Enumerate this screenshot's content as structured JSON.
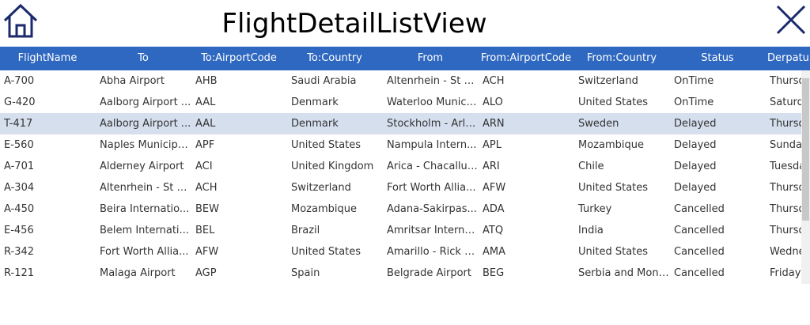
{
  "header": {
    "title": "FlightDetailListView",
    "home_icon": "home-icon",
    "close_icon": "close-icon",
    "icon_color": "#1a2a6c"
  },
  "table": {
    "header_color": "#2f68c0",
    "selected_row_color": "#d5dfee",
    "columns": [
      "FlightName",
      "To",
      "To:AirportCode",
      "To:Country",
      "From",
      "From:AirportCode",
      "From:Country",
      "Status",
      "Derpatu"
    ],
    "rows": [
      [
        "A-700",
        "Abha Airport",
        "AHB",
        "Saudi Arabia",
        "Altenrhein - St G...",
        "ACH",
        "Switzerland",
        "OnTime",
        "Thursd"
      ],
      [
        "G-420",
        "Aalborg Airport ...",
        "AAL",
        "Denmark",
        "Waterloo Munici...",
        "ALO",
        "United States",
        "OnTime",
        "Saturd"
      ],
      [
        "T-417",
        "Aalborg Airport ...",
        "AAL",
        "Denmark",
        "Stockholm - Arla...",
        "ARN",
        "Sweden",
        "Delayed",
        "Thursd"
      ],
      [
        "E-560",
        "Naples Municipa...",
        "APF",
        "United States",
        "Nampula Intern...",
        "APL",
        "Mozambique",
        "Delayed",
        "Sunday"
      ],
      [
        "A-701",
        "Alderney Airport",
        "ACI",
        "United Kingdom",
        "Arica - Chacallut...",
        "ARI",
        "Chile",
        "Delayed",
        "Tuesda"
      ],
      [
        "A-304",
        "Altenrhein - St G...",
        "ACH",
        "Switzerland",
        "Fort Worth Allia...",
        "AFW",
        "United States",
        "Delayed",
        "Thursd"
      ],
      [
        "A-450",
        "Beira Internatio...",
        "BEW",
        "Mozambique",
        "Adana-Sakirpas...",
        "ADA",
        "Turkey",
        "Cancelled",
        "Thursd"
      ],
      [
        "E-456",
        "Belem Internati...",
        "BEL",
        "Brazil",
        "Amritsar Interna...",
        "ATQ",
        "India",
        "Cancelled",
        "Thursd"
      ],
      [
        "R-342",
        "Fort Worth Allia...",
        "AFW",
        "United States",
        "Amarillo - Rick H...",
        "AMA",
        "United States",
        "Cancelled",
        "Wedne"
      ],
      [
        "R-121",
        "Malaga Airport",
        "AGP",
        "Spain",
        "Belgrade Airport",
        "BEG",
        "Serbia and Mont...",
        "Cancelled",
        "Friday, A"
      ]
    ],
    "selected_row": 2
  }
}
